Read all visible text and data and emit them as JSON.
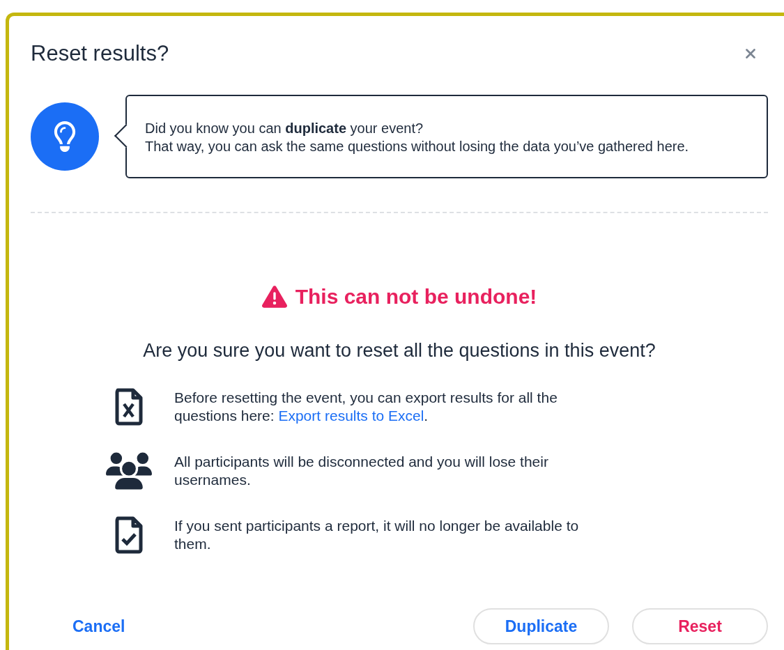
{
  "dialog": {
    "title": "Reset results?",
    "tip": {
      "lines": [
        "Did you know you can **duplicate** your event?",
        "That way, you can ask the same questions without losing the data you’ve gathered here."
      ]
    },
    "warning": "This can not be undone!",
    "question": "Are you sure you want to reset all the questions in this event?",
    "items": [
      {
        "kind": "excel",
        "text": "Before resetting the event, you can export results for all the questions here: ",
        "link": "Export results to Excel",
        "after": "."
      },
      {
        "kind": "people",
        "text": "All participants will be disconnected and you will lose their usernames."
      },
      {
        "kind": "report",
        "text": "If you sent participants a report, it will no longer be available to them."
      }
    ],
    "buttons": {
      "cancel": "Cancel",
      "duplicate": "Duplicate",
      "reset": "Reset"
    }
  }
}
